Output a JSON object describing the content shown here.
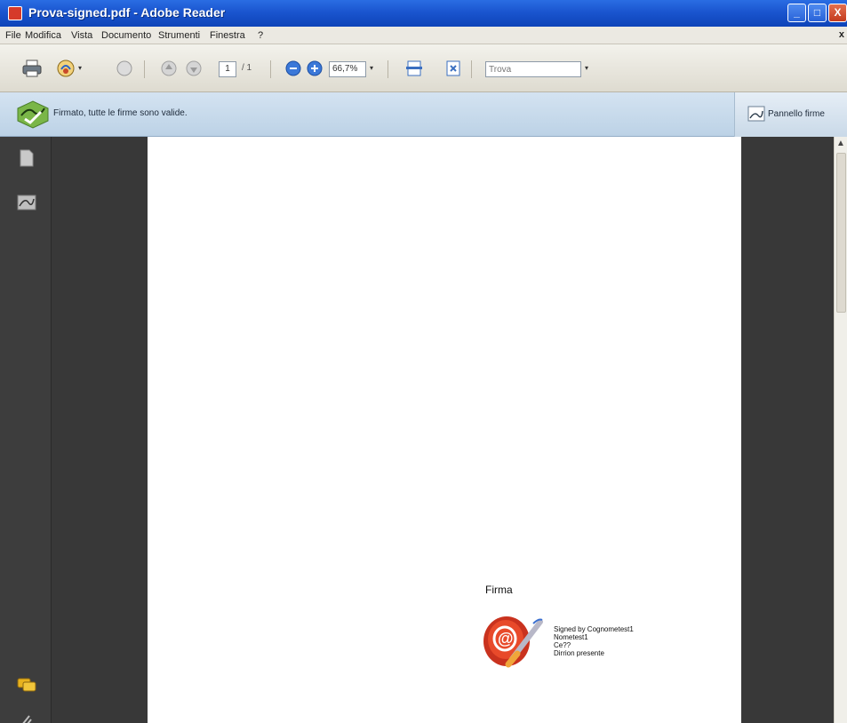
{
  "window": {
    "title": "Prova-signed.pdf - Adobe Reader",
    "minimize_label": "_",
    "maximize_label": "□",
    "close_label": "X"
  },
  "menu": {
    "items": [
      "File",
      "Modifica",
      "Vista",
      "Documento",
      "Strumenti",
      "Finestra",
      "?"
    ],
    "close_label": "x"
  },
  "toolbar": {
    "page_current": "1",
    "page_total": "/ 1",
    "zoom": "66,7%",
    "search_placeholder": "Trova"
  },
  "signature_bar": {
    "status": "Firmato, tutte le firme sono valide.",
    "panel_button": "Pannello firme"
  },
  "document": {
    "signature_title": "Firma",
    "signature_lines": [
      "Signed by Cognometest1",
      "Nometest1",
      "Ce??",
      "Dirrion presente"
    ]
  },
  "colors": {
    "titlebar": "#1a55cf",
    "signature_bar": "#c8dbeb",
    "nav_panel": "#3d3d3d",
    "doc_background": "#383838"
  }
}
